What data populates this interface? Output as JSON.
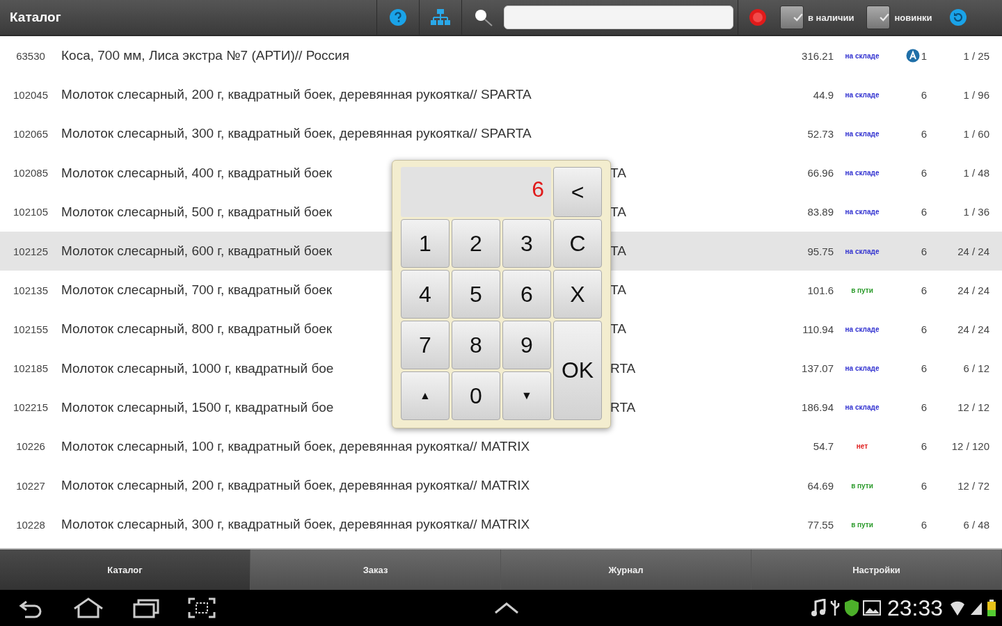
{
  "toolbar": {
    "title": "Каталог",
    "filters": [
      {
        "label": "в наличии",
        "checked": true
      },
      {
        "label": "новинки",
        "checked": true
      }
    ]
  },
  "rows": [
    {
      "code": "63530",
      "name": "Коса, 700 мм,  Лиса экстра №7 (АРТИ)// Россия",
      "price": "316.21",
      "stock": "на складе",
      "color": "#3030d0",
      "badge": true,
      "qty": "1",
      "pack": "1 / 25",
      "selected": false
    },
    {
      "code": "102045",
      "name": "Молоток слесарный, 200 г, квадратный боек, деревянная рукоятка// SPARTA",
      "price": "44.9",
      "stock": "на складе",
      "color": "#3030d0",
      "badge": false,
      "qty": "6",
      "pack": "1 / 96",
      "selected": false
    },
    {
      "code": "102065",
      "name": "Молоток слесарный, 300 г, квадратный боек, деревянная рукоятка// SPARTA",
      "price": "52.73",
      "stock": "на складе",
      "color": "#3030d0",
      "badge": false,
      "qty": "6",
      "pack": "1 / 60",
      "selected": false
    },
    {
      "code": "102085",
      "name": "Молоток слесарный, 400 г, квадратный боек",
      "name_tail": "TA",
      "price": "66.96",
      "stock": "на складе",
      "color": "#3030d0",
      "badge": false,
      "qty": "6",
      "pack": "1 / 48",
      "selected": false
    },
    {
      "code": "102105",
      "name": "Молоток слесарный, 500 г, квадратный боек",
      "name_tail": "TA",
      "price": "83.89",
      "stock": "на складе",
      "color": "#3030d0",
      "badge": false,
      "qty": "6",
      "pack": "1 / 36",
      "selected": false
    },
    {
      "code": "102125",
      "name": "Молоток слесарный, 600 г, квадратный боек",
      "name_tail": "TA",
      "price": "95.75",
      "stock": "на складе",
      "color": "#3030d0",
      "badge": false,
      "qty": "6",
      "pack": "24 / 24",
      "selected": true
    },
    {
      "code": "102135",
      "name": "Молоток слесарный, 700 г, квадратный боек",
      "name_tail": "TA",
      "price": "101.6",
      "stock": "в пути",
      "color": "#2a9a2a",
      "badge": false,
      "qty": "6",
      "pack": "24 / 24",
      "selected": false
    },
    {
      "code": "102155",
      "name": "Молоток слесарный, 800 г, квадратный боек",
      "name_tail": "TA",
      "price": "110.94",
      "stock": "на складе",
      "color": "#3030d0",
      "badge": false,
      "qty": "6",
      "pack": "24 / 24",
      "selected": false
    },
    {
      "code": "102185",
      "name": "Молоток слесарный, 1000 г, квадратный бое",
      "name_tail": "RTA",
      "price": "137.07",
      "stock": "на складе",
      "color": "#3030d0",
      "badge": false,
      "qty": "6",
      "pack": "6 / 12",
      "selected": false
    },
    {
      "code": "102215",
      "name": "Молоток слесарный, 1500 г, квадратный бое",
      "name_tail": "RTA",
      "price": "186.94",
      "stock": "на складе",
      "color": "#3030d0",
      "badge": false,
      "qty": "6",
      "pack": "12 / 12",
      "selected": false
    },
    {
      "code": "10226",
      "name": "Молоток слесарный, 100 г, квадратный боек, деревянная рукоятка// MATRIX",
      "price": "54.7",
      "stock": "нет",
      "color": "#e02020",
      "badge": false,
      "qty": "6",
      "pack": "12 / 120",
      "selected": false
    },
    {
      "code": "10227",
      "name": "Молоток слесарный, 200 г, квадратный боек, деревянная рукоятка// MATRIX",
      "price": "64.69",
      "stock": "в пути",
      "color": "#2a9a2a",
      "badge": false,
      "qty": "6",
      "pack": "12 / 72",
      "selected": false
    },
    {
      "code": "10228",
      "name": "Молоток слесарный, 300 г, квадратный боек, деревянная рукоятка// MATRIX",
      "price": "77.55",
      "stock": "в пути",
      "color": "#2a9a2a",
      "badge": false,
      "qty": "6",
      "pack": "6 / 48",
      "selected": false
    }
  ],
  "keypad": {
    "display": "6",
    "backspace": "<",
    "keys": [
      {
        "label": "1",
        "kind": "digit"
      },
      {
        "label": "2",
        "kind": "digit"
      },
      {
        "label": "3",
        "kind": "digit"
      },
      {
        "label": "C",
        "kind": "action"
      },
      {
        "label": "4",
        "kind": "digit"
      },
      {
        "label": "5",
        "kind": "digit"
      },
      {
        "label": "6",
        "kind": "digit"
      },
      {
        "label": "X",
        "kind": "action"
      },
      {
        "label": "7",
        "kind": "digit"
      },
      {
        "label": "8",
        "kind": "digit"
      },
      {
        "label": "9",
        "kind": "digit"
      },
      {
        "label": "OK",
        "kind": "ok"
      },
      {
        "label": "▲",
        "kind": "arrow"
      },
      {
        "label": "0",
        "kind": "digit"
      },
      {
        "label": "▼",
        "kind": "arrow"
      }
    ]
  },
  "tabs": [
    {
      "label": "Каталог",
      "selected": true
    },
    {
      "label": "Заказ",
      "selected": false
    },
    {
      "label": "Журнал",
      "selected": false
    },
    {
      "label": "Настройки",
      "selected": false
    }
  ],
  "status_bar": {
    "time": "23:33"
  }
}
